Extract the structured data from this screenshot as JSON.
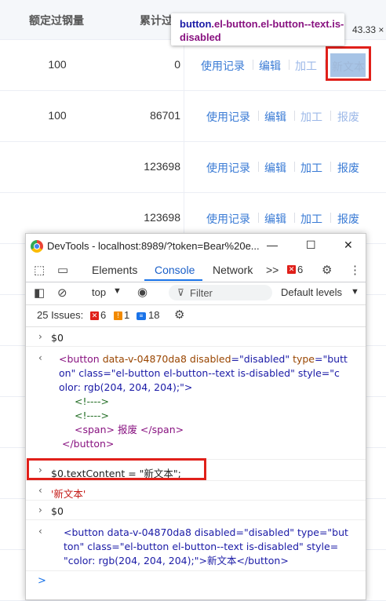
{
  "table": {
    "headers": [
      "额定过钢量",
      "累计过"
    ],
    "rows": [
      {
        "rated": "100",
        "cumulative": "0",
        "ops": [
          "使用记录",
          "编辑",
          "加工",
          "新文本"
        ]
      },
      {
        "rated": "100",
        "cumulative": "86701",
        "ops": [
          "使用记录",
          "编辑",
          "加工",
          "报废"
        ]
      },
      {
        "rated": "",
        "cumulative": "123698",
        "ops": [
          "使用记录",
          "编辑",
          "加工",
          "报废"
        ]
      },
      {
        "rated": "",
        "cumulative": "123698",
        "ops": [
          "使用记录",
          "编辑",
          "加工",
          "报废"
        ]
      }
    ]
  },
  "tooltip": {
    "element": "button",
    "classes": ".el-button.el-button--text.is-disabled",
    "size": "43.33 ×"
  },
  "devtools": {
    "title": "DevTools - localhost:8989/?token=Bear%20e...",
    "tabs": [
      "Elements",
      "Console",
      "Network"
    ],
    "active_tab": "Console",
    "more_tabs": ">>",
    "error_count": "6",
    "context": "top",
    "filter_placeholder": "Filter",
    "levels": "Default levels",
    "issues_label": "25 Issues:",
    "issues_errors": "6",
    "issues_warnings": "1",
    "issues_info": "18"
  },
  "console": {
    "cmd1": "$0",
    "out1_line1_a": "<button ",
    "out1_line1_b": "data-v-04870da8 ",
    "out1_line1_c": "disabled",
    "out1_line1_d": "=\"disabled\" ",
    "out1_line1_e": "type",
    "out1_line1_f": "=\"butt",
    "out1_line2": "on\" class=\"el-button el-button--text is-disabled\" style=\"c",
    "out1_line3": "olor: rgb(204, 204, 204);\">",
    "out1_comment1": "<!---->",
    "out1_comment2": "<!---->",
    "out1_span": "<span> 报废 </span>",
    "out1_close": "</button>",
    "cmd2": "$0.textContent = \"新文本\";",
    "result2": "'新文本'",
    "cmd3": "$0",
    "out3_line1": "<button data-v-04870da8 disabled=\"disabled\" type=\"but",
    "out3_line2": "ton\" class=\"el-button el-button--text is-disabled\" style=",
    "out3_line3": "\"color: rgb(204, 204, 204);\">新文本</button>",
    "prompt": ">"
  },
  "colors": {
    "link": "#3a7bd5",
    "disabled": "#9cb8e8",
    "highlight_box": "#e0201a",
    "active_tab": "#1a73e8"
  }
}
